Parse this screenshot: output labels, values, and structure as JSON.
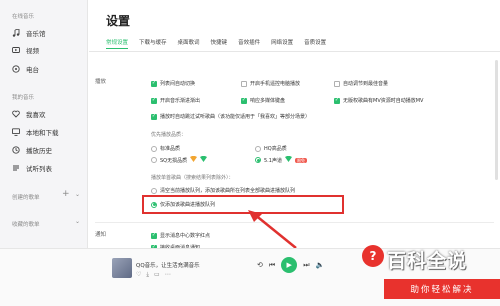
{
  "sidebar": {
    "section_online": "在线音乐",
    "items_online": [
      {
        "label": "音乐馆",
        "icon": "music-note-icon"
      },
      {
        "label": "视频",
        "icon": "video-icon"
      },
      {
        "label": "电台",
        "icon": "radio-icon"
      }
    ],
    "section_mine": "我的音乐",
    "items_mine": [
      {
        "label": "我喜欢",
        "icon": "heart-icon"
      },
      {
        "label": "本地和下载",
        "icon": "computer-icon"
      },
      {
        "label": "播放历史",
        "icon": "history-icon"
      },
      {
        "label": "试听列表",
        "icon": "list-icon"
      }
    ],
    "created_playlists": "创建的歌单",
    "collected_playlists": "收藏的歌单"
  },
  "settings": {
    "title": "设置",
    "tabs": [
      "常规设置",
      "下载与缓存",
      "桌面歌词",
      "快捷键",
      "音效插件",
      "网络设置",
      "音质设置"
    ],
    "playback": {
      "label": "播放",
      "checkboxes": [
        {
          "label": "列表间自动切换",
          "checked": true
        },
        {
          "label": "开启手机遥控电脑播放",
          "checked": false
        },
        {
          "label": "自动调节到最佳音量",
          "checked": false
        },
        {
          "label": "开启音乐渐进渐出",
          "checked": true
        },
        {
          "label": "响应多媒体键盘",
          "checked": true
        },
        {
          "label": "无版权歌曲有MV资源时自动播放MV",
          "checked": true
        },
        {
          "label": "播放时自动跳过试听歌曲（该功能仅适用于「我喜欢」等部分场景）",
          "checked": true
        }
      ],
      "quality_label": "优先播放品质：",
      "quality_options": [
        {
          "label": "标准品质",
          "selected": false
        },
        {
          "label": "HQ高品质",
          "selected": false
        },
        {
          "label": "SQ无损品质",
          "selected": false
        },
        {
          "label": "5.1声道",
          "selected": true,
          "badge": "限免"
        }
      ],
      "queue_label": "播放单首歌曲（搜索结果列表除外）：",
      "queue_options": [
        {
          "label": "清空当前播放队列，添加该歌曲所在列表全部歌曲进播放队列",
          "selected": false
        },
        {
          "label": "仅添加该歌曲进播放队列",
          "selected": true
        }
      ]
    },
    "notify": {
      "label": "通知",
      "checkboxes": [
        {
          "label": "显示消息中心数字红点",
          "checked": true
        },
        {
          "label": "接收桌面消息通知",
          "checked": true
        }
      ]
    }
  },
  "player": {
    "track": "QQ音乐，让生活充满音乐"
  },
  "watermark": {
    "title": "百科全说",
    "subtitle": "助你轻松解决"
  },
  "colors": {
    "accent": "#2bbf6f",
    "highlight": "#e0312f",
    "brand_red": "#e8322d"
  }
}
